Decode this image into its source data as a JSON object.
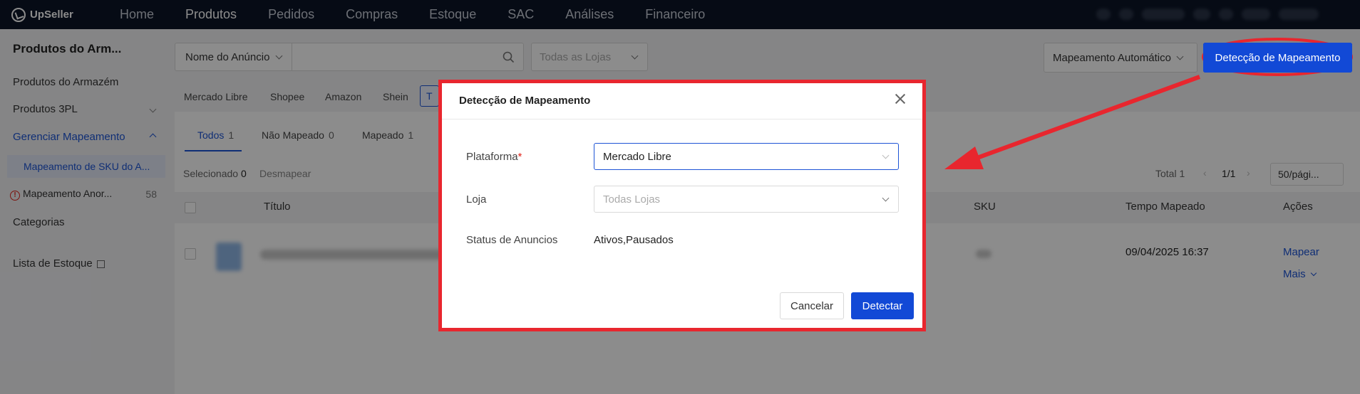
{
  "app": {
    "logo": "UpSeller"
  },
  "nav": {
    "items": [
      "Home",
      "Produtos",
      "Pedidos",
      "Compras",
      "Estoque",
      "SAC",
      "Análises",
      "Financeiro"
    ],
    "active_index": 1
  },
  "sidebar": {
    "title": "Produtos do Arm...",
    "items": {
      "armazem": "Produtos do Armazém",
      "p3pl": "Produtos 3PL",
      "gerenciar": "Gerenciar Mapeamento",
      "sku_map": "Mapeamento de SKU do A...",
      "anom": "Mapeamento Anor...",
      "anom_count": "58",
      "categorias": "Categorias",
      "estoque": "Lista de Estoque"
    }
  },
  "toolbar": {
    "search_field": "Nome do Anúncio",
    "store_filter": "Todas as Lojas",
    "auto_map": "Mapeamento Automático",
    "detect_btn": "Detecção de Mapeamento"
  },
  "platform_tabs": [
    "Mercado Libre",
    "Shopee",
    "Amazon",
    "Shein",
    "T"
  ],
  "status_tabs": [
    {
      "label": "Todos",
      "count": "1"
    },
    {
      "label": "Não Mapeado",
      "count": "0"
    },
    {
      "label": "Mapeado",
      "count": "1"
    }
  ],
  "list": {
    "selected_label": "Selecionado",
    "selected_count": "0",
    "unmap": "Desmapear",
    "total": "Total 1",
    "page": "1/1",
    "per_page": "50/pági...",
    "columns": {
      "title": "Título",
      "sku": "SKU",
      "time": "Tempo Mapeado",
      "actions": "Ações"
    },
    "row": {
      "time": "09/04/2025 16:37",
      "map": "Mapear",
      "more": "Mais"
    }
  },
  "modal": {
    "title": "Detecção de Mapeamento",
    "platform_label": "Plataforma",
    "platform_value": "Mercado Libre",
    "store_label": "Loja",
    "store_placeholder": "Todas Lojas",
    "status_label": "Status de Anuncios",
    "status_value": "Ativos,Pausados",
    "cancel": "Cancelar",
    "detect": "Detectar"
  },
  "colors": {
    "accent": "#1249d6",
    "highlight": "#e8262e",
    "nav_bg": "#0c1527"
  }
}
